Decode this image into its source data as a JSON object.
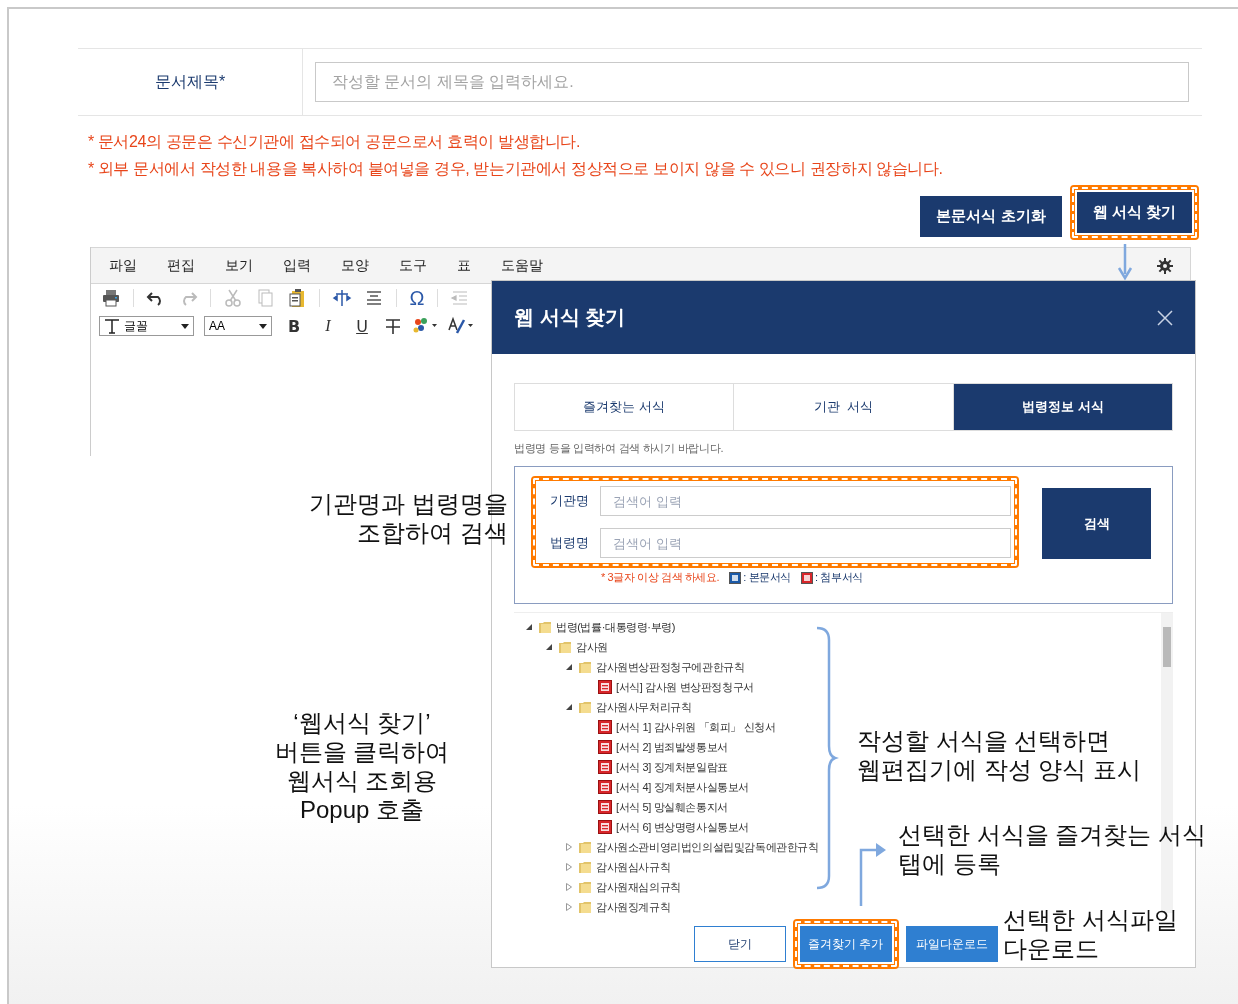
{
  "document_title": {
    "label": "문서제목*",
    "placeholder": "작성할 문서의 제목을 입력하세요."
  },
  "notices": [
    "* 문서24의 공문은 수신기관에 접수되어 공문으로서 효력이 발생합니다.",
    "* 외부 문서에서 작성한 내용을 복사하여 붙여넣을 경우, 받는기관에서 정상적으로 보이지 않을 수 있으니 권장하지 않습니다."
  ],
  "actions": [
    {
      "label": "본문서식 초기화",
      "highlighted": false
    },
    {
      "label": "웹 서식 찾기",
      "highlighted": true
    }
  ],
  "editor": {
    "menu": [
      "파일",
      "편집",
      "보기",
      "입력",
      "모양",
      "도구",
      "표",
      "도움말"
    ],
    "symbol_glyph": "Ω",
    "font_select": "글꼴",
    "size_select": "AA",
    "format_glyphs": [
      "B",
      "I",
      "U"
    ]
  },
  "dialog": {
    "title": "웹 서식 찾기",
    "tabs": [
      {
        "label": "즐겨찾는 서식",
        "selected": false
      },
      {
        "label": "기관  서식",
        "selected": false
      },
      {
        "label": "법령정보 서식",
        "selected": true
      }
    ],
    "hint": "법령명 등을 입력하여 검색 하시기 바랍니다.",
    "search": {
      "highlighted": true,
      "fields": [
        {
          "label": "기관명",
          "placeholder": "검색어 입력"
        },
        {
          "label": "법령명",
          "placeholder": "검색어 입력"
        }
      ],
      "button": "검색",
      "note": "* 3글자 이상 검색 하세요.",
      "legend": [
        {
          "kind": "body",
          "label": ": 본문서식"
        },
        {
          "kind": "attachment",
          "label": ": 첨부서식"
        }
      ]
    },
    "tree": [
      {
        "kind": "folder",
        "label": "법령(법률·대통령령·부령)",
        "expanded": true,
        "children": [
          {
            "kind": "folder",
            "label": "감사원",
            "expanded": true,
            "children": [
              {
                "kind": "folder",
                "label": "감사원변상판정청구에관한규칙",
                "expanded": true,
                "children": [
                  {
                    "kind": "form",
                    "label": "[서식] 감사원 변상판정청구서"
                  }
                ]
              },
              {
                "kind": "folder",
                "label": "감사원사무처리규칙",
                "expanded": true,
                "children": [
                  {
                    "kind": "form",
                    "label": "[서식 1] 감사위원 「회피」 신청서"
                  },
                  {
                    "kind": "form",
                    "label": "[서식 2] 범죄발생통보서"
                  },
                  {
                    "kind": "form",
                    "label": "[서식 3] 징계처분일람표"
                  },
                  {
                    "kind": "form",
                    "label": "[서식 4] 징계처분사실통보서"
                  },
                  {
                    "kind": "form",
                    "label": "[서식 5] 망실훼손통지서"
                  },
                  {
                    "kind": "form",
                    "label": "[서식 6] 변상명령사실통보서"
                  }
                ]
              },
              {
                "kind": "folder",
                "label": "감사원소관비영리법인의설립및감독에관한규칙",
                "expanded": false
              },
              {
                "kind": "folder",
                "label": "감사원심사규칙",
                "expanded": false
              },
              {
                "kind": "folder",
                "label": "감사원재심의규칙",
                "expanded": false
              },
              {
                "kind": "folder",
                "label": "감사원징계규칙",
                "expanded": false
              }
            ]
          }
        ]
      }
    ],
    "buttons": [
      {
        "label": "닫기",
        "kind": "outline",
        "highlighted": false
      },
      {
        "label": "즐겨찾기 추가",
        "kind": "primary",
        "highlighted": true
      },
      {
        "label": "파일다운로드",
        "kind": "primary",
        "highlighted": false
      }
    ]
  },
  "annotations": [
    {
      "kind": "search",
      "lines": [
        "기관명과 법령명을",
        "조합하여 검색"
      ]
    },
    {
      "kind": "popup",
      "lines": [
        "‘웹서식 찾기’",
        "버튼을 클릭하여",
        "웹서식 조회용",
        "Popup 호출"
      ]
    },
    {
      "kind": "select",
      "lines": [
        "작성할 서식을 선택하면",
        "웹편집기에 작성 양식 표시"
      ]
    },
    {
      "kind": "favorite",
      "lines": [
        "선택한 서식을 즐겨찾는 서식",
        "탭에 등록"
      ]
    },
    {
      "kind": "download",
      "lines": [
        "선택한 서식파일",
        "다운로드"
      ]
    }
  ]
}
